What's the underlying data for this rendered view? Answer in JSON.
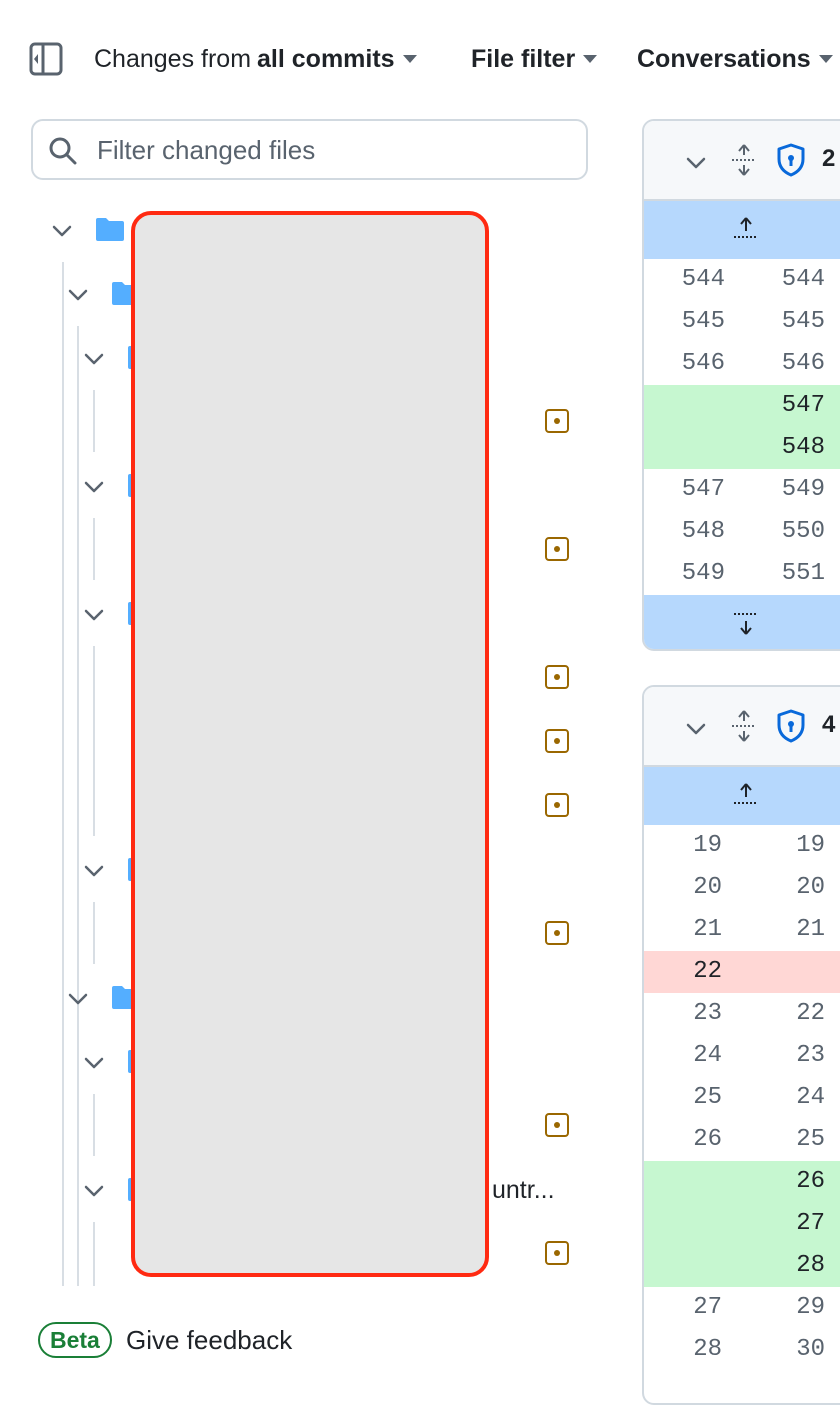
{
  "toolbar": {
    "changes_prefix": "Changes from ",
    "changes_bold": "all commits",
    "file_filter": "File filter",
    "conversations": "Conversations"
  },
  "filter": {
    "placeholder": "Filter changed files"
  },
  "tree": {
    "truncated_name": "untr..."
  },
  "feedback": {
    "badge": "Beta",
    "label": "Give feedback"
  },
  "diff1": {
    "file_count": "2",
    "rows": [
      {
        "old": "544",
        "new": "544",
        "type": "ctx"
      },
      {
        "old": "545",
        "new": "545",
        "type": "ctx"
      },
      {
        "old": "546",
        "new": "546",
        "type": "ctx"
      },
      {
        "old": "",
        "new": "547",
        "type": "add"
      },
      {
        "old": "",
        "new": "548",
        "type": "add"
      },
      {
        "old": "547",
        "new": "549",
        "type": "ctx"
      },
      {
        "old": "548",
        "new": "550",
        "type": "ctx"
      },
      {
        "old": "549",
        "new": "551",
        "type": "ctx"
      }
    ]
  },
  "diff2": {
    "file_count": "4",
    "rows": [
      {
        "old": "19",
        "new": "19",
        "type": "ctx"
      },
      {
        "old": "20",
        "new": "20",
        "type": "ctx"
      },
      {
        "old": "21",
        "new": "21",
        "type": "ctx"
      },
      {
        "old": "22",
        "new": "",
        "type": "del"
      },
      {
        "old": "23",
        "new": "22",
        "type": "ctx"
      },
      {
        "old": "24",
        "new": "23",
        "type": "ctx"
      },
      {
        "old": "25",
        "new": "24",
        "type": "ctx"
      },
      {
        "old": "26",
        "new": "25",
        "type": "ctx"
      },
      {
        "old": "",
        "new": "26",
        "type": "add"
      },
      {
        "old": "",
        "new": "27",
        "type": "add"
      },
      {
        "old": "",
        "new": "28",
        "type": "add"
      },
      {
        "old": "27",
        "new": "29",
        "type": "ctx"
      },
      {
        "old": "28",
        "new": "30",
        "type": "ctx"
      }
    ]
  },
  "colors": {
    "accent": "#0969da",
    "folder": "#54aeff",
    "modified": "#9a6700",
    "added_bg": "#c6f7d0",
    "deleted_bg": "#ffd7d5",
    "expand_bg": "#b6d8fd",
    "redaction": "#ff2a12"
  }
}
